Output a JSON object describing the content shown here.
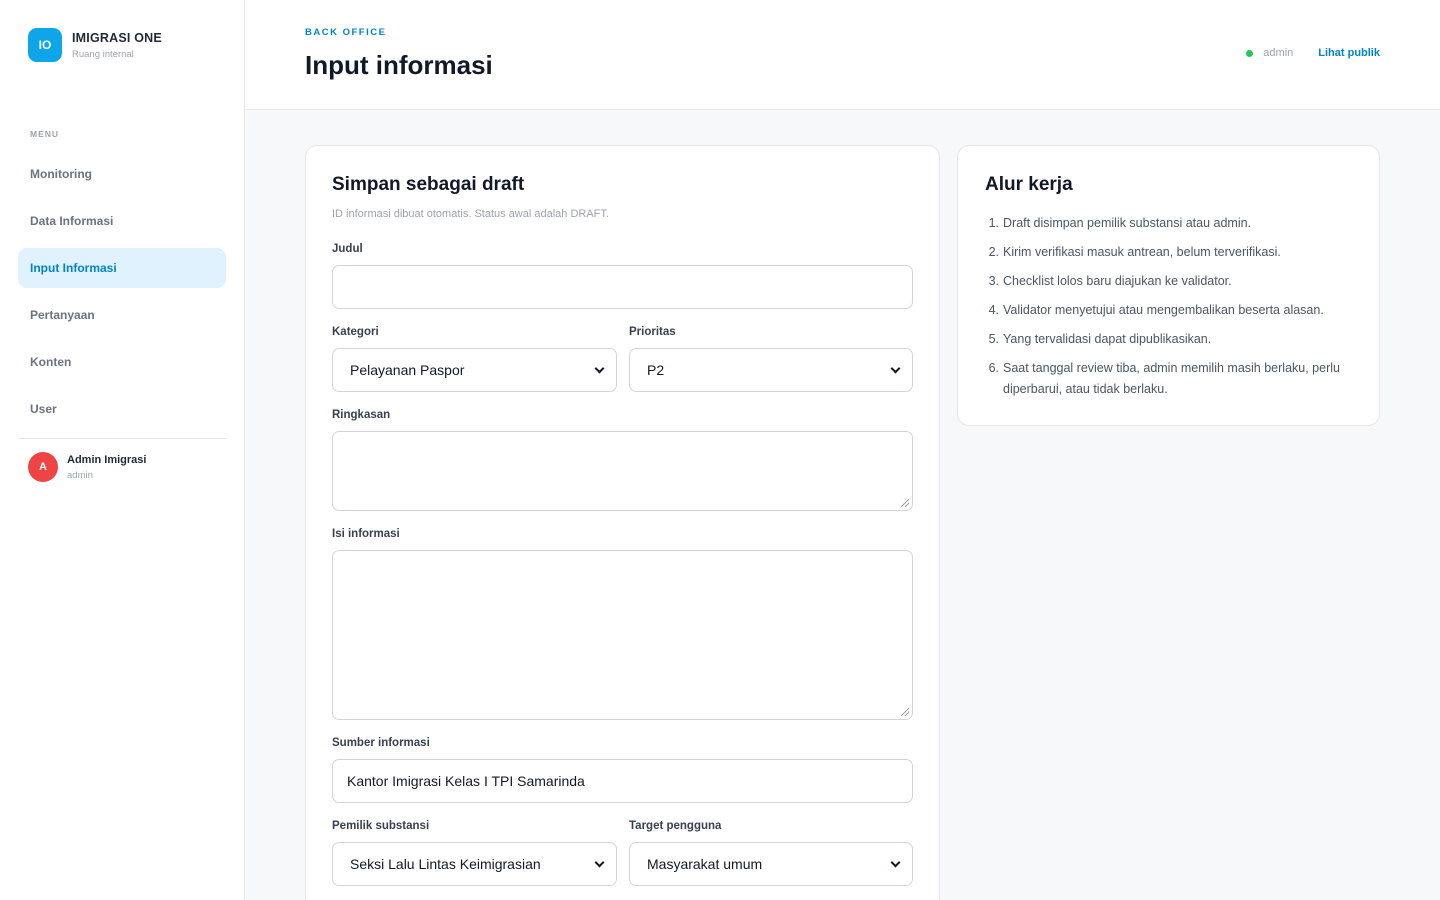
{
  "brand": {
    "logo": "IO",
    "name": "IMIGRASI ONE",
    "subtitle": "Ruang internal"
  },
  "sidebar": {
    "menu_label": "MENU",
    "items": [
      {
        "label": "Monitoring",
        "active": false
      },
      {
        "label": "Data Informasi",
        "active": false
      },
      {
        "label": "Input Informasi",
        "active": true
      },
      {
        "label": "Pertanyaan",
        "active": false
      },
      {
        "label": "Konten",
        "active": false
      },
      {
        "label": "User",
        "active": false
      }
    ],
    "user": {
      "initial": "A",
      "name": "Admin Imigrasi",
      "role": "admin"
    }
  },
  "header": {
    "eyebrow": "BACK OFFICE",
    "title": "Input informasi",
    "status": "admin",
    "status_color": "#22c55e",
    "public_link": "Lihat publik"
  },
  "form": {
    "title": "Simpan sebagai draft",
    "subtitle": "ID informasi dibuat otomatis. Status awal adalah DRAFT.",
    "judul": {
      "label": "Judul",
      "value": ""
    },
    "kategori": {
      "label": "Kategori",
      "value": "Pelayanan Paspor"
    },
    "prioritas": {
      "label": "Prioritas",
      "value": "P2"
    },
    "ringkasan": {
      "label": "Ringkasan",
      "value": ""
    },
    "isi": {
      "label": "Isi informasi",
      "value": ""
    },
    "sumber": {
      "label": "Sumber informasi",
      "value": "Kantor Imigrasi Kelas I TPI Samarinda"
    },
    "pemilik": {
      "label": "Pemilik substansi",
      "value": "Seksi Lalu Lintas Keimigrasian"
    },
    "target": {
      "label": "Target pengguna",
      "value": "Masyarakat umum"
    }
  },
  "workflow": {
    "title": "Alur kerja",
    "steps": [
      "Draft disimpan pemilik substansi atau admin.",
      "Kirim verifikasi masuk antrean, belum terverifikasi.",
      "Checklist lolos baru diajukan ke validator.",
      "Validator menyetujui atau mengembalikan beserta alasan.",
      "Yang tervalidasi dapat dipublikasikan.",
      "Saat tanggal review tiba, admin memilih masih berlaku, perlu diperbarui, atau tidak berlaku."
    ]
  },
  "colors": {
    "accent": "#0284c7",
    "brand": "#0ea5e9",
    "active_bg": "#e0f2fe",
    "avatar": "#ef4444"
  }
}
